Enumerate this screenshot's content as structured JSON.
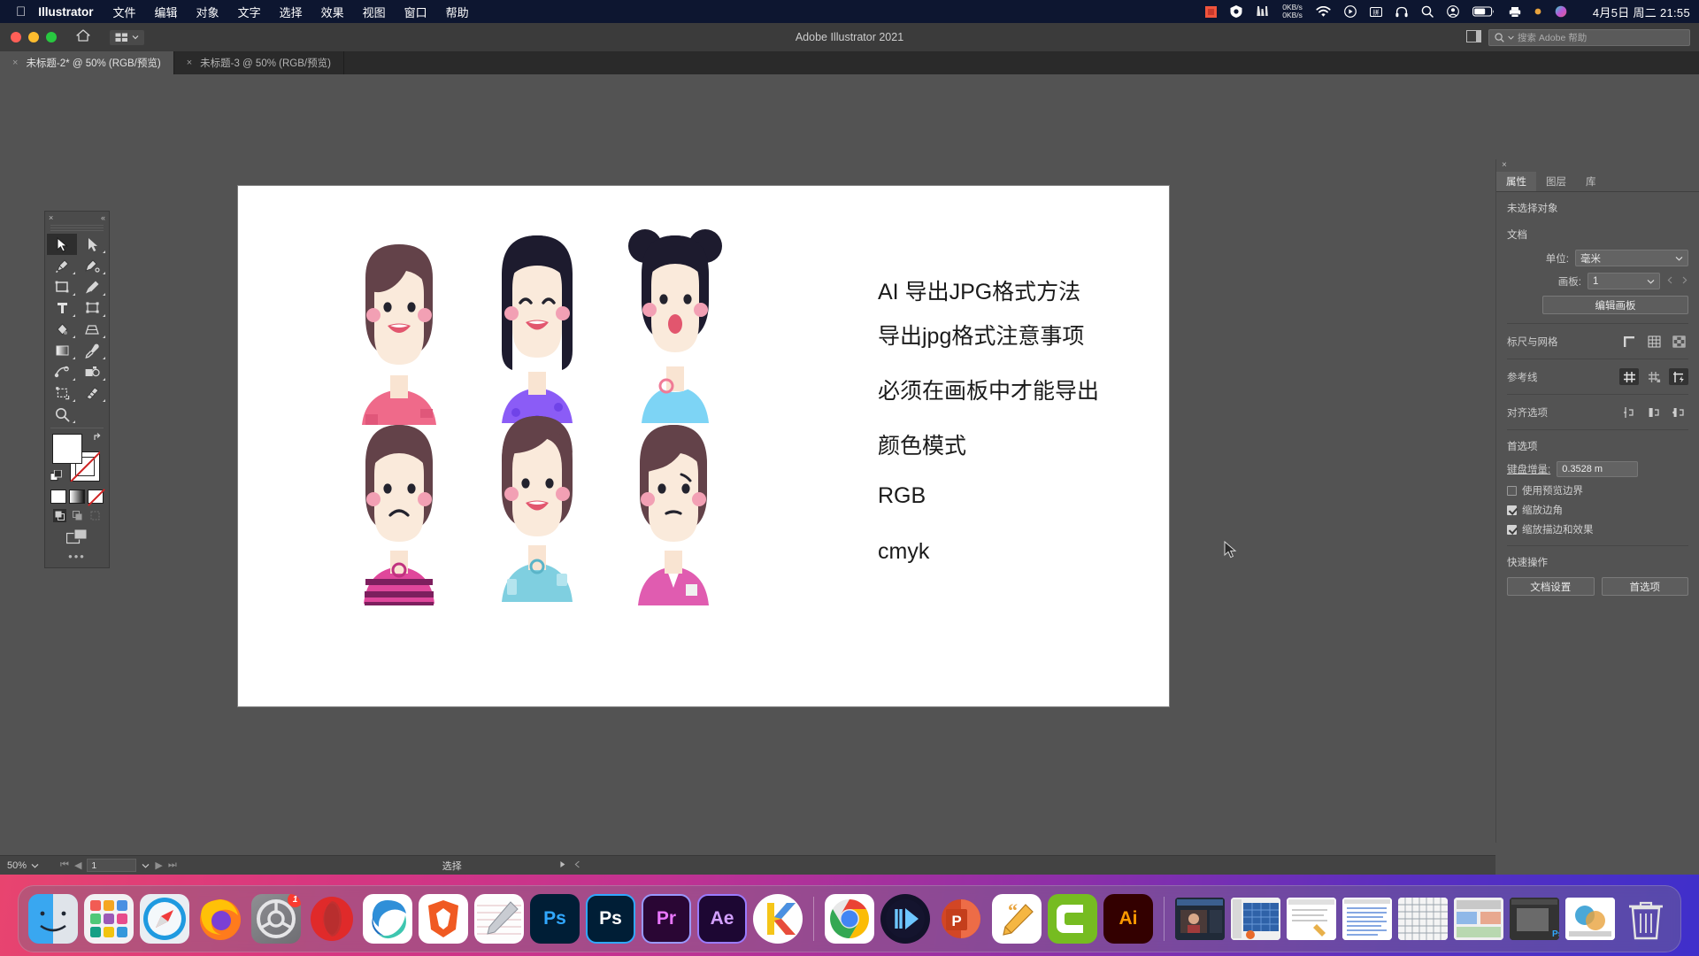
{
  "menubar": {
    "apple_icon": "apple-logo-icon",
    "app_name": "Illustrator",
    "items": [
      "文件",
      "编辑",
      "对象",
      "文字",
      "选择",
      "效果",
      "视图",
      "窗口",
      "帮助"
    ],
    "tray": {
      "net_up": "0KB/s",
      "net_down": "0KB/s",
      "clock": "4月5日 周二  21:55",
      "icons": [
        "red-square-icon",
        "shield-icon",
        "chart-icon",
        "wifi-icon",
        "play-circle-icon",
        "keyboard-input-icon",
        "headphones-icon",
        "search-icon",
        "user-icon",
        "battery-icon",
        "printer-icon",
        "dot-icon",
        "siri-icon",
        "control-center-icon"
      ]
    }
  },
  "titlebar": {
    "app_title": "Adobe Illustrator 2021",
    "home_icon": "home-icon",
    "arrange_icon": "arrange-documents-icon",
    "search_placeholder": "搜索 Adobe 帮助",
    "search_icon": "search-icon",
    "workspace_icon": "workspace-switcher-icon"
  },
  "doc_tabs": [
    {
      "label": "未标题-2* @ 50% (RGB/预览)",
      "active": true,
      "close": "×"
    },
    {
      "label": "未标题-3 @ 50% (RGB/预览)",
      "active": false,
      "close": "×"
    }
  ],
  "toolbar": {
    "close": "×",
    "collapse": "«",
    "tools": [
      {
        "name": "selection-tool",
        "selected": true
      },
      {
        "name": "direct-selection-tool",
        "selected": false
      },
      {
        "name": "pen-tool",
        "selected": false
      },
      {
        "name": "curvature-tool",
        "selected": false
      },
      {
        "name": "rectangle-tool",
        "selected": false
      },
      {
        "name": "paintbrush-tool",
        "selected": false
      },
      {
        "name": "type-tool",
        "selected": false
      },
      {
        "name": "free-transform-tool",
        "selected": false
      },
      {
        "name": "shape-builder-tool",
        "selected": false
      },
      {
        "name": "perspective-grid-tool",
        "selected": false
      },
      {
        "name": "gradient-tool",
        "selected": false
      },
      {
        "name": "eyedropper-tool",
        "selected": false
      },
      {
        "name": "blend-tool",
        "selected": false
      },
      {
        "name": "symbol-sprayer-tool",
        "selected": false
      },
      {
        "name": "artboard-tool",
        "selected": false
      },
      {
        "name": "slice-tool",
        "selected": false
      },
      {
        "name": "zoom-tool",
        "selected": false
      }
    ],
    "fill_color": "#ffffff",
    "stroke_color": "#ffffff",
    "more_tools": "•••"
  },
  "artboard": {
    "text_lines": [
      "AI 导出JPG格式方法",
      "导出jpg格式注意事项",
      "必须在画板中才能导出",
      "颜色模式",
      "RGB",
      "cmyk"
    ]
  },
  "properties_panel": {
    "close": "×",
    "tabs": [
      {
        "label": "属性",
        "active": true
      },
      {
        "label": "图层",
        "active": false
      },
      {
        "label": "库",
        "active": false
      }
    ],
    "no_selection": "未选择对象",
    "document": {
      "heading": "文档",
      "unit_label": "单位:",
      "unit_value": "毫米",
      "artboard_label": "画板:",
      "artboard_value": "1",
      "edit_artboards_button": "编辑画板"
    },
    "rulers_grid": {
      "label": "标尺与网格",
      "icons": [
        "show-rulers-icon",
        "show-grid-icon",
        "show-transparency-grid-icon"
      ]
    },
    "guides": {
      "label": "参考线",
      "icons": [
        "show-guides-icon",
        "lock-guides-icon",
        "smart-guides-icon"
      ]
    },
    "align_options": {
      "label": "对齐选项",
      "icons": [
        "align-to-pixel-grid-icon",
        "align-to-glyph-icon",
        "align-to-point-icon"
      ]
    },
    "preferences": {
      "heading": "首选项",
      "keyboard_increment_label": "键盘增量:",
      "keyboard_increment_value": "0.3528 m",
      "checkboxes": [
        {
          "label": "使用预览边界",
          "checked": false
        },
        {
          "label": "缩放边角",
          "checked": true
        },
        {
          "label": "缩放描边和效果",
          "checked": true
        }
      ]
    },
    "quick_actions": {
      "heading": "快速操作",
      "buttons": [
        "文档设置",
        "首选项"
      ]
    }
  },
  "statusbar": {
    "zoom": "50%",
    "artboard_number": "1",
    "current_tool": "选择",
    "nav_first": "⏮",
    "nav_prev": "◀",
    "nav_next": "▶",
    "nav_last": "⏭"
  },
  "dock": {
    "apps": [
      {
        "name": "finder",
        "label": "",
        "running": true
      },
      {
        "name": "launchpad",
        "label": "",
        "running": false
      },
      {
        "name": "safari",
        "label": "",
        "running": false
      },
      {
        "name": "firefox",
        "label": "",
        "running": false
      },
      {
        "name": "system-preferences",
        "label": "",
        "running": false,
        "badge": "1"
      },
      {
        "name": "opera",
        "label": "",
        "running": false
      },
      {
        "name": "microsoft-edge",
        "label": "",
        "running": false
      },
      {
        "name": "brave-browser",
        "label": "",
        "running": false
      },
      {
        "name": "notes",
        "label": "",
        "running": false
      },
      {
        "name": "photoshop-cc",
        "label": "Ps",
        "running": true
      },
      {
        "name": "photoshop-2021",
        "label": "Ps",
        "running": false
      },
      {
        "name": "premiere-pro",
        "label": "Pr",
        "running": false
      },
      {
        "name": "after-effects",
        "label": "Ae",
        "running": false
      },
      {
        "name": "keka",
        "label": "K",
        "running": false
      },
      {
        "name": "google-chrome",
        "label": "",
        "running": true
      },
      {
        "name": "iina-player",
        "label": "",
        "running": false
      },
      {
        "name": "powerpoint",
        "label": "P",
        "running": true
      },
      {
        "name": "ulysses",
        "label": "",
        "running": true
      },
      {
        "name": "camtasia",
        "label": "C",
        "running": true
      },
      {
        "name": "illustrator",
        "label": "Ai",
        "running": true
      }
    ],
    "minimized_windows": [
      "video-window",
      "spreadsheet-window",
      "document-window",
      "text-document-window",
      "grid-window",
      "presentation-window",
      "ps-window",
      "image-window"
    ],
    "trash": "trash-icon"
  },
  "colors": {
    "menubar_bg": "#0d1630",
    "app_chrome": "#535353",
    "panel_bg": "#535353",
    "tab_bar": "#2a2a2a",
    "artboard": "#ffffff",
    "accent_pink": "#e8446f",
    "accent_purple": "#5a2fc0"
  }
}
